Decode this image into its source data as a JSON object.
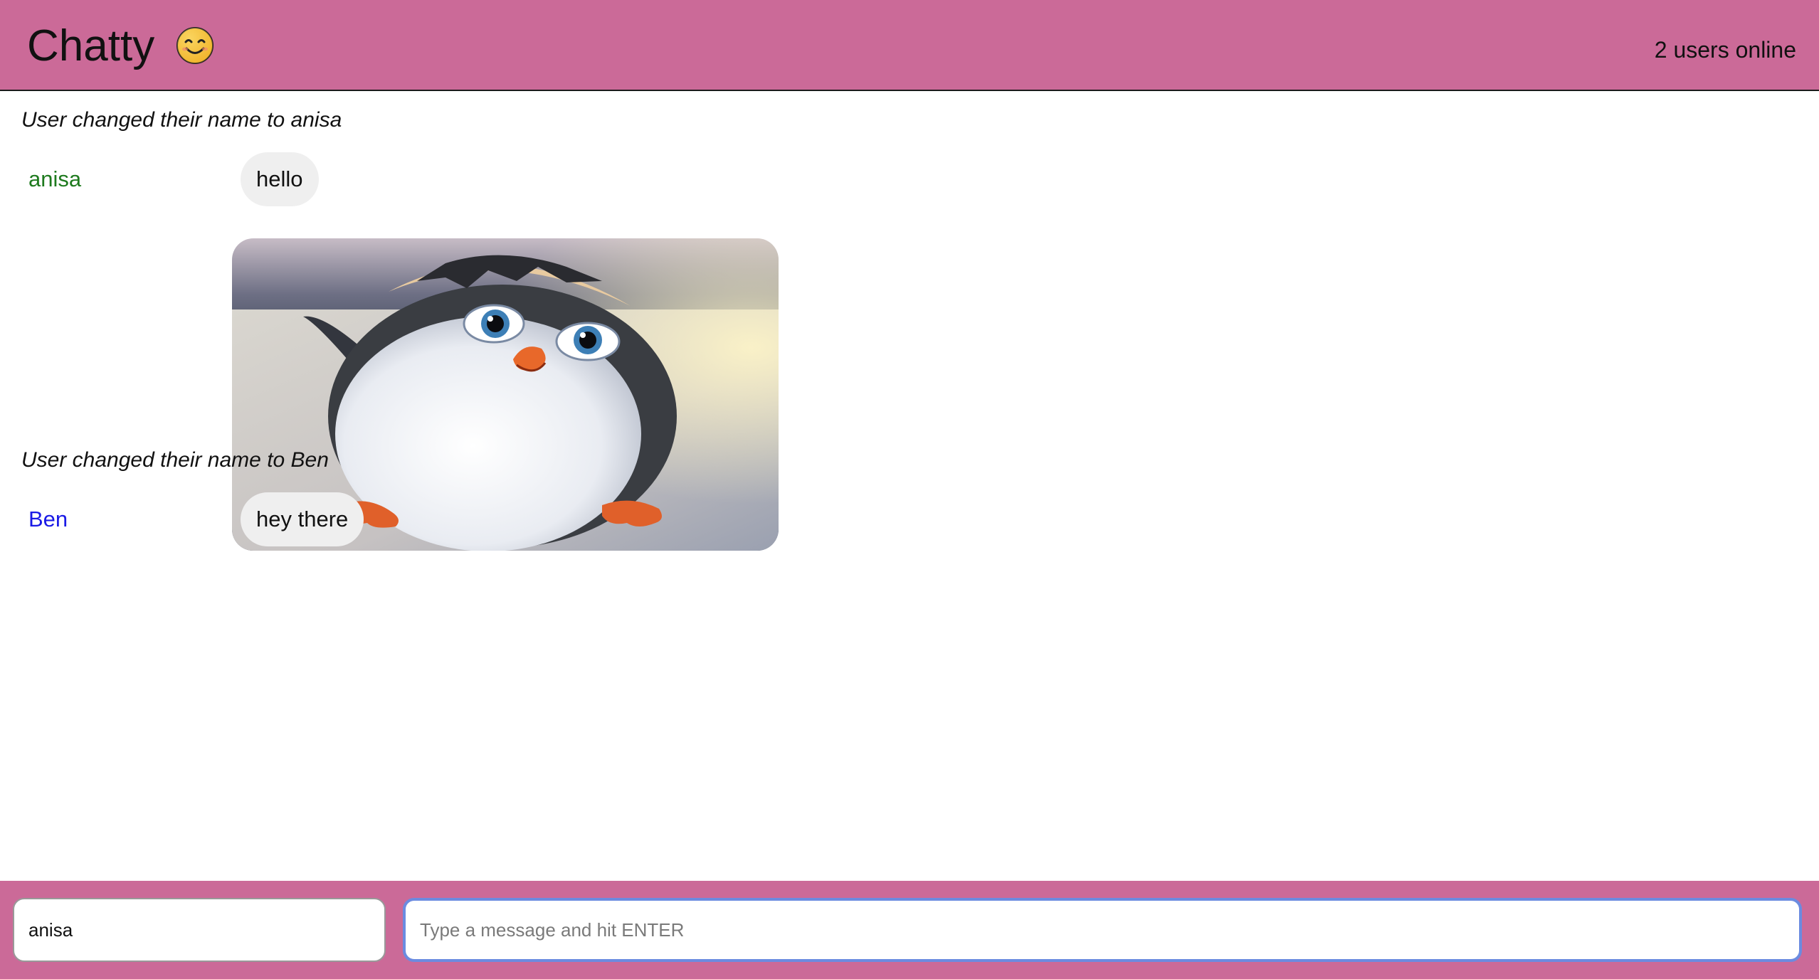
{
  "navbar": {
    "brand": "Chatty",
    "brand_icon": "smiling-face-emoji",
    "users_online": "2 users online",
    "background": "#cb6a98"
  },
  "messages": [
    {
      "type": "system",
      "text": "User changed their name to anisa"
    },
    {
      "type": "chat",
      "username": "anisa",
      "username_color": "#1e7a1e",
      "content": "hello"
    },
    {
      "type": "image",
      "username": "",
      "content": "penguin-image"
    },
    {
      "type": "system",
      "text": "User changed their name to Ben"
    },
    {
      "type": "chat",
      "username": "Ben",
      "username_color": "#1a1ae6",
      "content": "hey there"
    }
  ],
  "footer": {
    "username_value": "anisa",
    "message_placeholder": "Type a message and hit ENTER",
    "background": "#cb6a98"
  }
}
